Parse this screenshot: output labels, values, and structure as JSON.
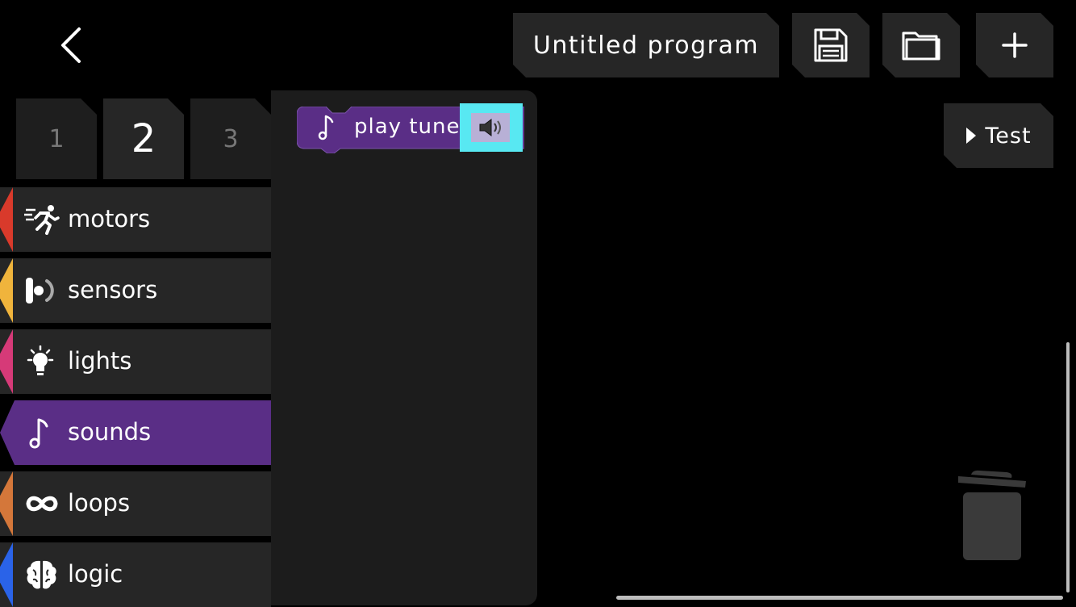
{
  "header": {
    "program_title": "Untitled program",
    "icons": {
      "back": "chevron-left-icon",
      "save": "floppy-disk-icon",
      "open": "folder-icon",
      "new": "plus-icon"
    }
  },
  "page_tabs": [
    {
      "label": "1",
      "active": false
    },
    {
      "label": "2",
      "active": true
    },
    {
      "label": "3",
      "active": false
    }
  ],
  "categories": [
    {
      "label": "motors",
      "icon": "running-person-icon",
      "color": "#d93a2b",
      "active": false
    },
    {
      "label": "sensors",
      "icon": "sensor-icon",
      "color": "#f0b43c",
      "active": false
    },
    {
      "label": "lights",
      "icon": "lightbulb-icon",
      "color": "#d63a78",
      "active": false
    },
    {
      "label": "sounds",
      "icon": "music-note-icon",
      "color": "#5a2e86",
      "active": true
    },
    {
      "label": "loops",
      "icon": "infinity-icon",
      "color": "#d4773a",
      "active": false
    },
    {
      "label": "logic",
      "icon": "brain-icon",
      "color": "#2a63e8",
      "active": false
    }
  ],
  "palette": {
    "blocks": [
      {
        "label": "play tune",
        "icon": "music-note-icon",
        "slot_icon": "speaker-icon",
        "color": "#5a2e86",
        "slot_color": "#58e8f2"
      }
    ]
  },
  "canvas": {
    "test_label": "Test",
    "trash_icon": "trash-can-icon"
  }
}
